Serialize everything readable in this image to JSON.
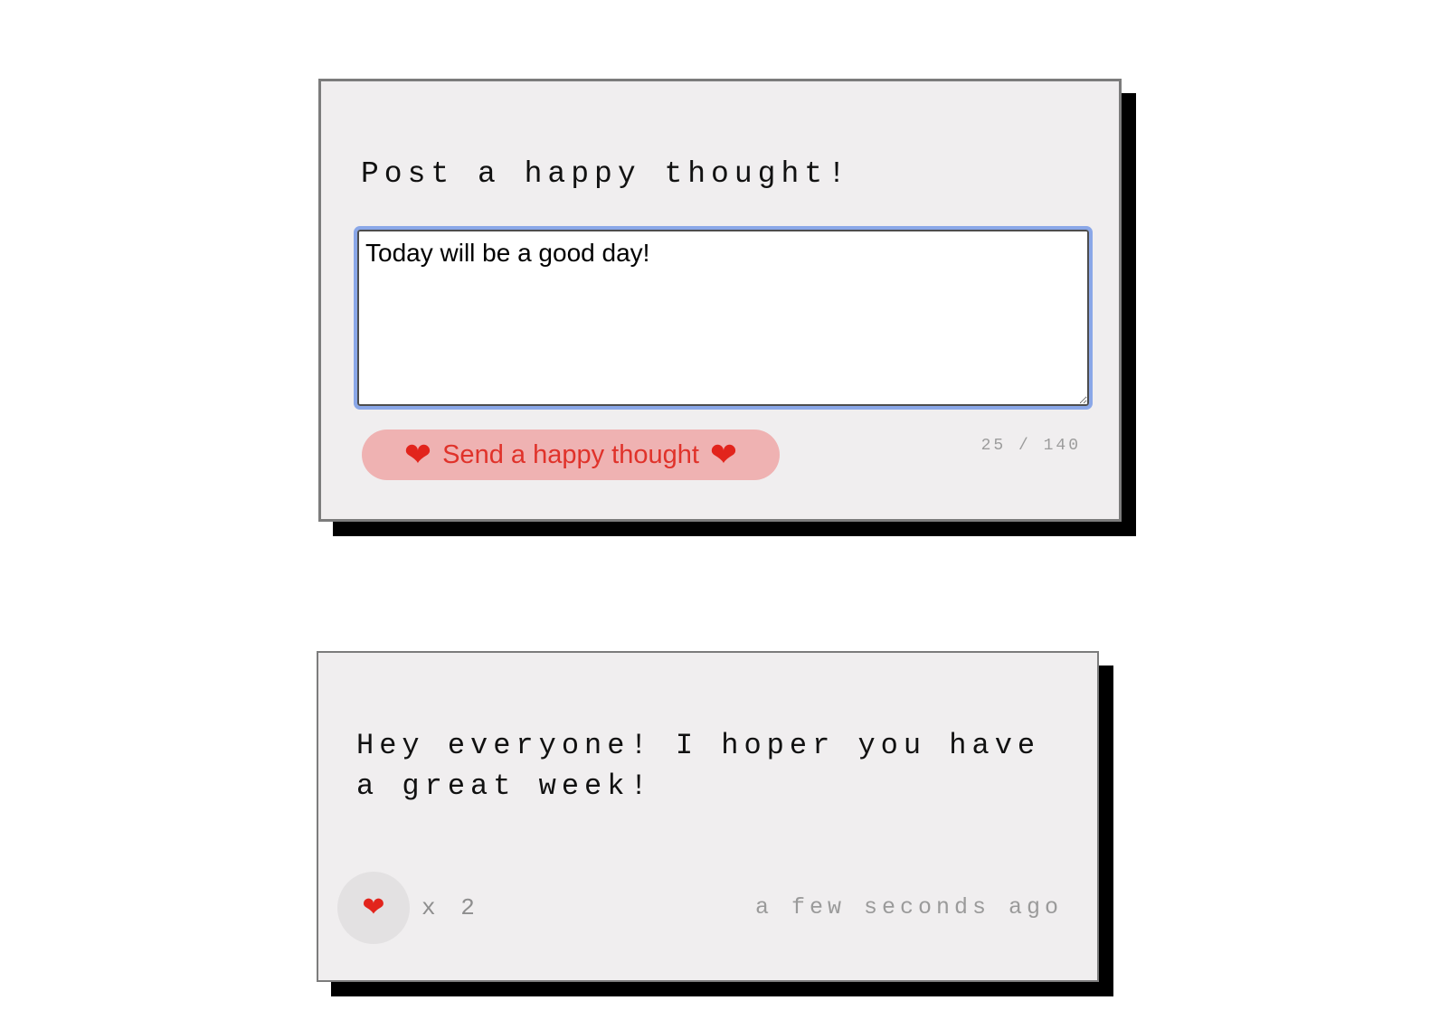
{
  "form": {
    "title": "Post a happy thought!",
    "input_value": "Today will be a good day!",
    "send_button_label": "Send a happy thought",
    "heart_glyph": "❤",
    "char_count": "25 / 140"
  },
  "thought": {
    "message": "Hey everyone! I hoper you have a great week!",
    "heart_glyph": "❤",
    "likes_label": "x 2",
    "likes": 2,
    "timestamp": "a few seconds ago"
  },
  "colors": {
    "card_background": "#f0eeef",
    "shadow": "#000000",
    "button_background": "#efb2b2",
    "button_text": "#e0322a",
    "focus_ring": "#8aa7e8"
  },
  "icons": {
    "heart": "heart-icon",
    "resize": "resize-handle-icon"
  }
}
